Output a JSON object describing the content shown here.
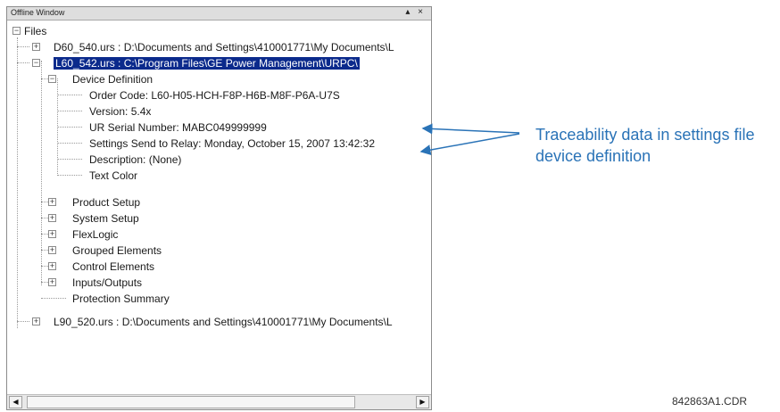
{
  "window": {
    "title": "Offline Window",
    "title_buttons": "▴ ×"
  },
  "tree": {
    "root": "Files",
    "file1": "D60_540.urs : D:\\Documents and Settings\\410001771\\My Documents\\L",
    "file2": "L60_542.urs : C:\\Program Files\\GE Power Management\\URPC\\",
    "device_definition": "Device Definition",
    "order_code": "Order Code: L60-H05-HCH-F8P-H6B-M8F-P6A-U7S",
    "version": "Version: 5.4x",
    "serial_number": "UR Serial Number: MABC049999999",
    "settings_send": "Settings Send to Relay: Monday, October 15, 2007 13:42:32",
    "description": "Description: (None)",
    "text_color": "Text Color",
    "product_setup": "Product Setup",
    "system_setup": "System Setup",
    "flexlogic": "FlexLogic",
    "grouped_elements": "Grouped Elements",
    "control_elements": "Control Elements",
    "inputs_outputs": "Inputs/Outputs",
    "protection_summary": "Protection Summary",
    "file3": "L90_520.urs : D:\\Documents and Settings\\410001771\\My Documents\\L"
  },
  "callout": {
    "text": "Traceability data in settings file device definition",
    "color": "#2a73b7"
  },
  "figure_id": "842863A1.CDR",
  "scroll": {
    "left_arrow": "◀",
    "right_arrow": "▶"
  }
}
